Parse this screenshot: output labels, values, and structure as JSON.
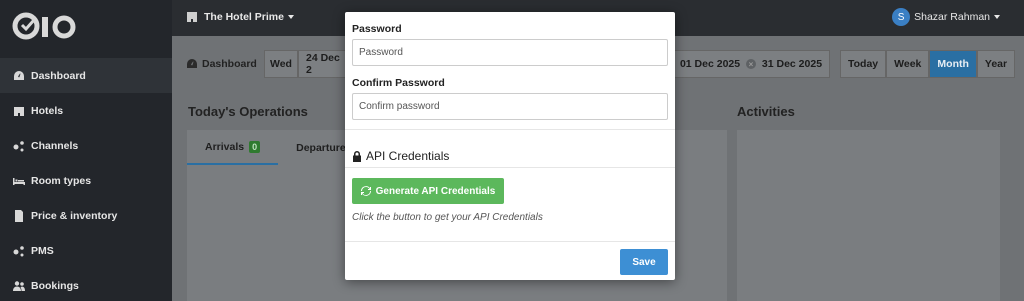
{
  "sidebar": {
    "items": [
      {
        "label": "Dashboard",
        "icon": "dashboard-icon"
      },
      {
        "label": "Hotels",
        "icon": "hotel-icon"
      },
      {
        "label": "Channels",
        "icon": "channels-icon"
      },
      {
        "label": "Room types",
        "icon": "bed-icon"
      },
      {
        "label": "Price & inventory",
        "icon": "document-icon"
      },
      {
        "label": "PMS",
        "icon": "pms-icon"
      },
      {
        "label": "Bookings",
        "icon": "users-icon"
      }
    ]
  },
  "header": {
    "hotel_name": "The Hotel Prime",
    "user_initial": "S",
    "user_name": "Shazar Rahman"
  },
  "toolbar": {
    "dashboard_label": "Dashboard",
    "day_label": "Wed",
    "date_label": "24 Dec 2",
    "range_start": "01 Dec 2025",
    "range_end": "31 Dec 2025",
    "periods": [
      "Today",
      "Week",
      "Month",
      "Year"
    ],
    "active_period": "Month"
  },
  "main": {
    "operations_title": "Today's Operations",
    "activities_title": "Activities",
    "tabs": [
      {
        "label": "Arrivals",
        "count": "0"
      },
      {
        "label": "Departures"
      }
    ]
  },
  "modal": {
    "password_label": "Password",
    "password_placeholder": "Password",
    "confirm_label": "Confirm Password",
    "confirm_placeholder": "Confirm password",
    "api_title": "API Credentials",
    "generate_button": "Generate API Credentials",
    "hint": "Click the button to get your API Credentials",
    "save_button": "Save"
  },
  "colors": {
    "sidebar_bg": "#23262b",
    "primary": "#3d8fd4",
    "success": "#5cb85c",
    "overlay": "#6f7275"
  }
}
